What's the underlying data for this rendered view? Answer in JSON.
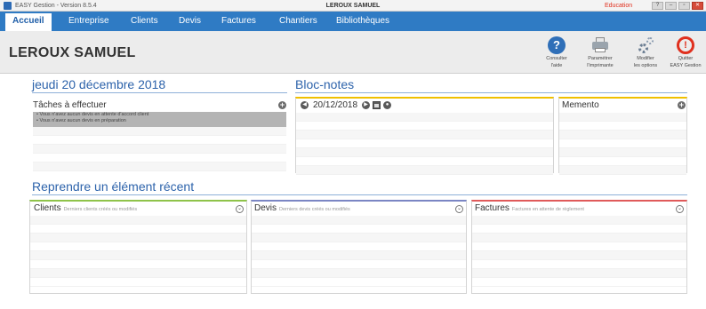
{
  "titlebar": {
    "app_version": "EASY Gestion - Version 8.5.4",
    "window_title": "LEROUX SAMUEL",
    "edition": "Education",
    "buttons": [
      "?",
      "–",
      "▫",
      "✕"
    ]
  },
  "menu": {
    "items": [
      "Accueil",
      "Entreprise",
      "Clients",
      "Devis",
      "Factures",
      "Chantiers",
      "Bibliothèques"
    ],
    "active": "Accueil"
  },
  "header": {
    "user_name": "LEROUX SAMUEL",
    "tools": [
      {
        "label_1": "Consulter",
        "label_2": "l'aide",
        "icon": "help-icon"
      },
      {
        "label_1": "Paramétrer",
        "label_2": "l'imprimante",
        "icon": "printer-icon"
      },
      {
        "label_1": "Modifier",
        "label_2": "les options",
        "icon": "gear-icon"
      },
      {
        "label_1": "Quitter",
        "label_2": "EASY Gestion",
        "icon": "power-icon"
      }
    ]
  },
  "agenda": {
    "date_title": "jeudi 20 décembre 2018",
    "tasks_title": "Tâches à effectuer",
    "tasks": [
      "• Vous n'avez aucun devis en attente d'accord client",
      "• Vous n'avez aucun devis en préparation"
    ]
  },
  "bloc_notes": {
    "title": "Bloc-notes",
    "date": "20/12/2018",
    "memento_title": "Memento",
    "accent_color": "#f0c000"
  },
  "recent": {
    "title": "Reprendre un élément récent",
    "cards": [
      {
        "title": "Clients",
        "subtitle": "Derniers clients créés ou modifiés",
        "color": "#8fc34a"
      },
      {
        "title": "Devis",
        "subtitle": "Derniers devis créés ou modifiés",
        "color": "#7b86c4"
      },
      {
        "title": "Factures",
        "subtitle": "Factures en attente de règlement",
        "color": "#e05a5a"
      }
    ]
  },
  "colors": {
    "menu_bar": "#2f7bc4",
    "section_title": "#2d63ab",
    "quit_red": "#e0301e"
  }
}
